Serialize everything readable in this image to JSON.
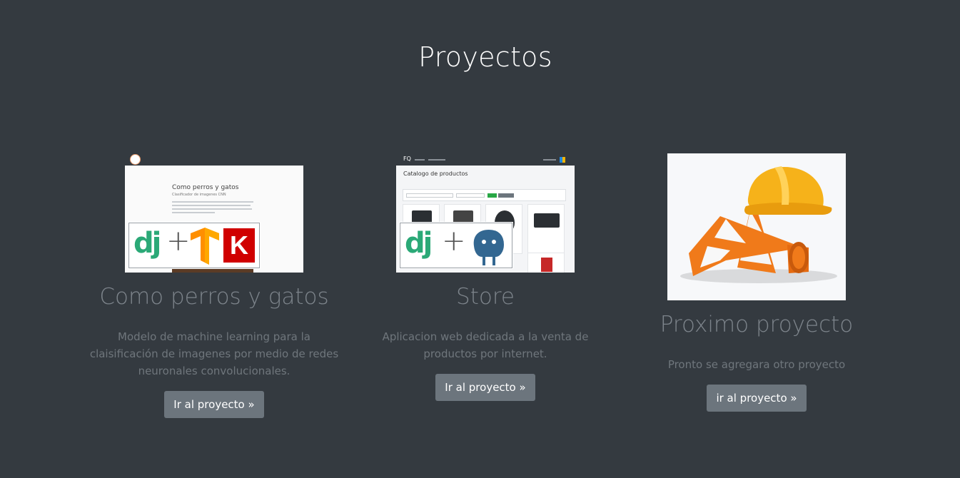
{
  "section": {
    "title": "Proyectos"
  },
  "projects": [
    {
      "title": "Como perros y gatos",
      "description": "Modelo de machine learning para la claisificación de imagenes por medio de redes neuronales convolucionales.",
      "button_label": "Ir al proyecto »",
      "thumbnail": {
        "heading": "Como perros y gatos",
        "subheading": "Clasificador de imagenes CNN",
        "logos": [
          "django-logo",
          "tensorflow-logo",
          "keras-logo"
        ]
      }
    },
    {
      "title": "Store",
      "description": "Aplicacion web dedicada a la venta de productos por internet.",
      "button_label": "Ir al proyecto »",
      "thumbnail": {
        "brand": "FQ",
        "heading": "Catalogo de productos",
        "logos": [
          "django-logo",
          "postgresql-logo"
        ]
      }
    },
    {
      "title": "Proximo proyecto",
      "description": "Pronto se agregara otro proyecto",
      "button_label": "ir al proyecto »",
      "thumbnail": {
        "image": "under-construction-cones-helmet"
      }
    }
  ],
  "colors": {
    "background": "#343a40",
    "button": "#6c757d",
    "muted_text": "#6f767c",
    "django_green": "#2ba977",
    "keras_red": "#d00000",
    "tensorflow_orange": "#ff8f00",
    "postgres_blue": "#336791"
  },
  "logos": {
    "django": "dj",
    "keras": "K"
  }
}
